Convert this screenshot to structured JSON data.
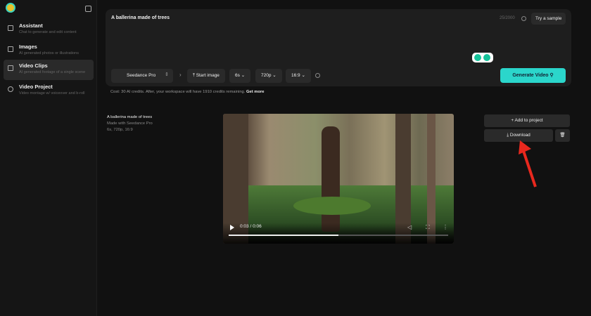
{
  "sidebar": {
    "items": [
      {
        "label": "Assistant",
        "subtitle": "Chat to generate and edit content",
        "icon": "chat-plus-icon"
      },
      {
        "label": "Images",
        "subtitle": "AI generated photos or illustrations",
        "icon": "image-icon"
      },
      {
        "label": "Video Clips",
        "subtitle": "AI generated footage of a single scene",
        "icon": "film-icon",
        "active": true
      },
      {
        "label": "Video Project",
        "subtitle": "Video montage w/ voiceover and b-roll",
        "icon": "sparkle-icon"
      }
    ]
  },
  "prompt": {
    "text": "A ballerina made of trees",
    "count": "25/2000",
    "sample": "Try a sample"
  },
  "toolbar": {
    "model": "Seedance Pro",
    "start_image": "Start image",
    "duration": "6s",
    "resolution": "720p",
    "aspect": "16:9",
    "generate": "Generate Video"
  },
  "cost": {
    "text": "Cost: 30 AI credits. After, your workspace will have 1910 credits remaining.",
    "link": "Get more"
  },
  "result": {
    "title": "A ballerina made of trees",
    "made_with": "Made with Seedance Pro",
    "specs": "6s, 720p, 16:9"
  },
  "player": {
    "time": "0:03 / 0:06",
    "progress": 0.5,
    "buffered": 0.6
  },
  "actions": {
    "add": "+ Add to project",
    "download": "⤓ Download"
  },
  "colors": {
    "accent": "#2bd6cb",
    "arrow": "#e8281e"
  }
}
